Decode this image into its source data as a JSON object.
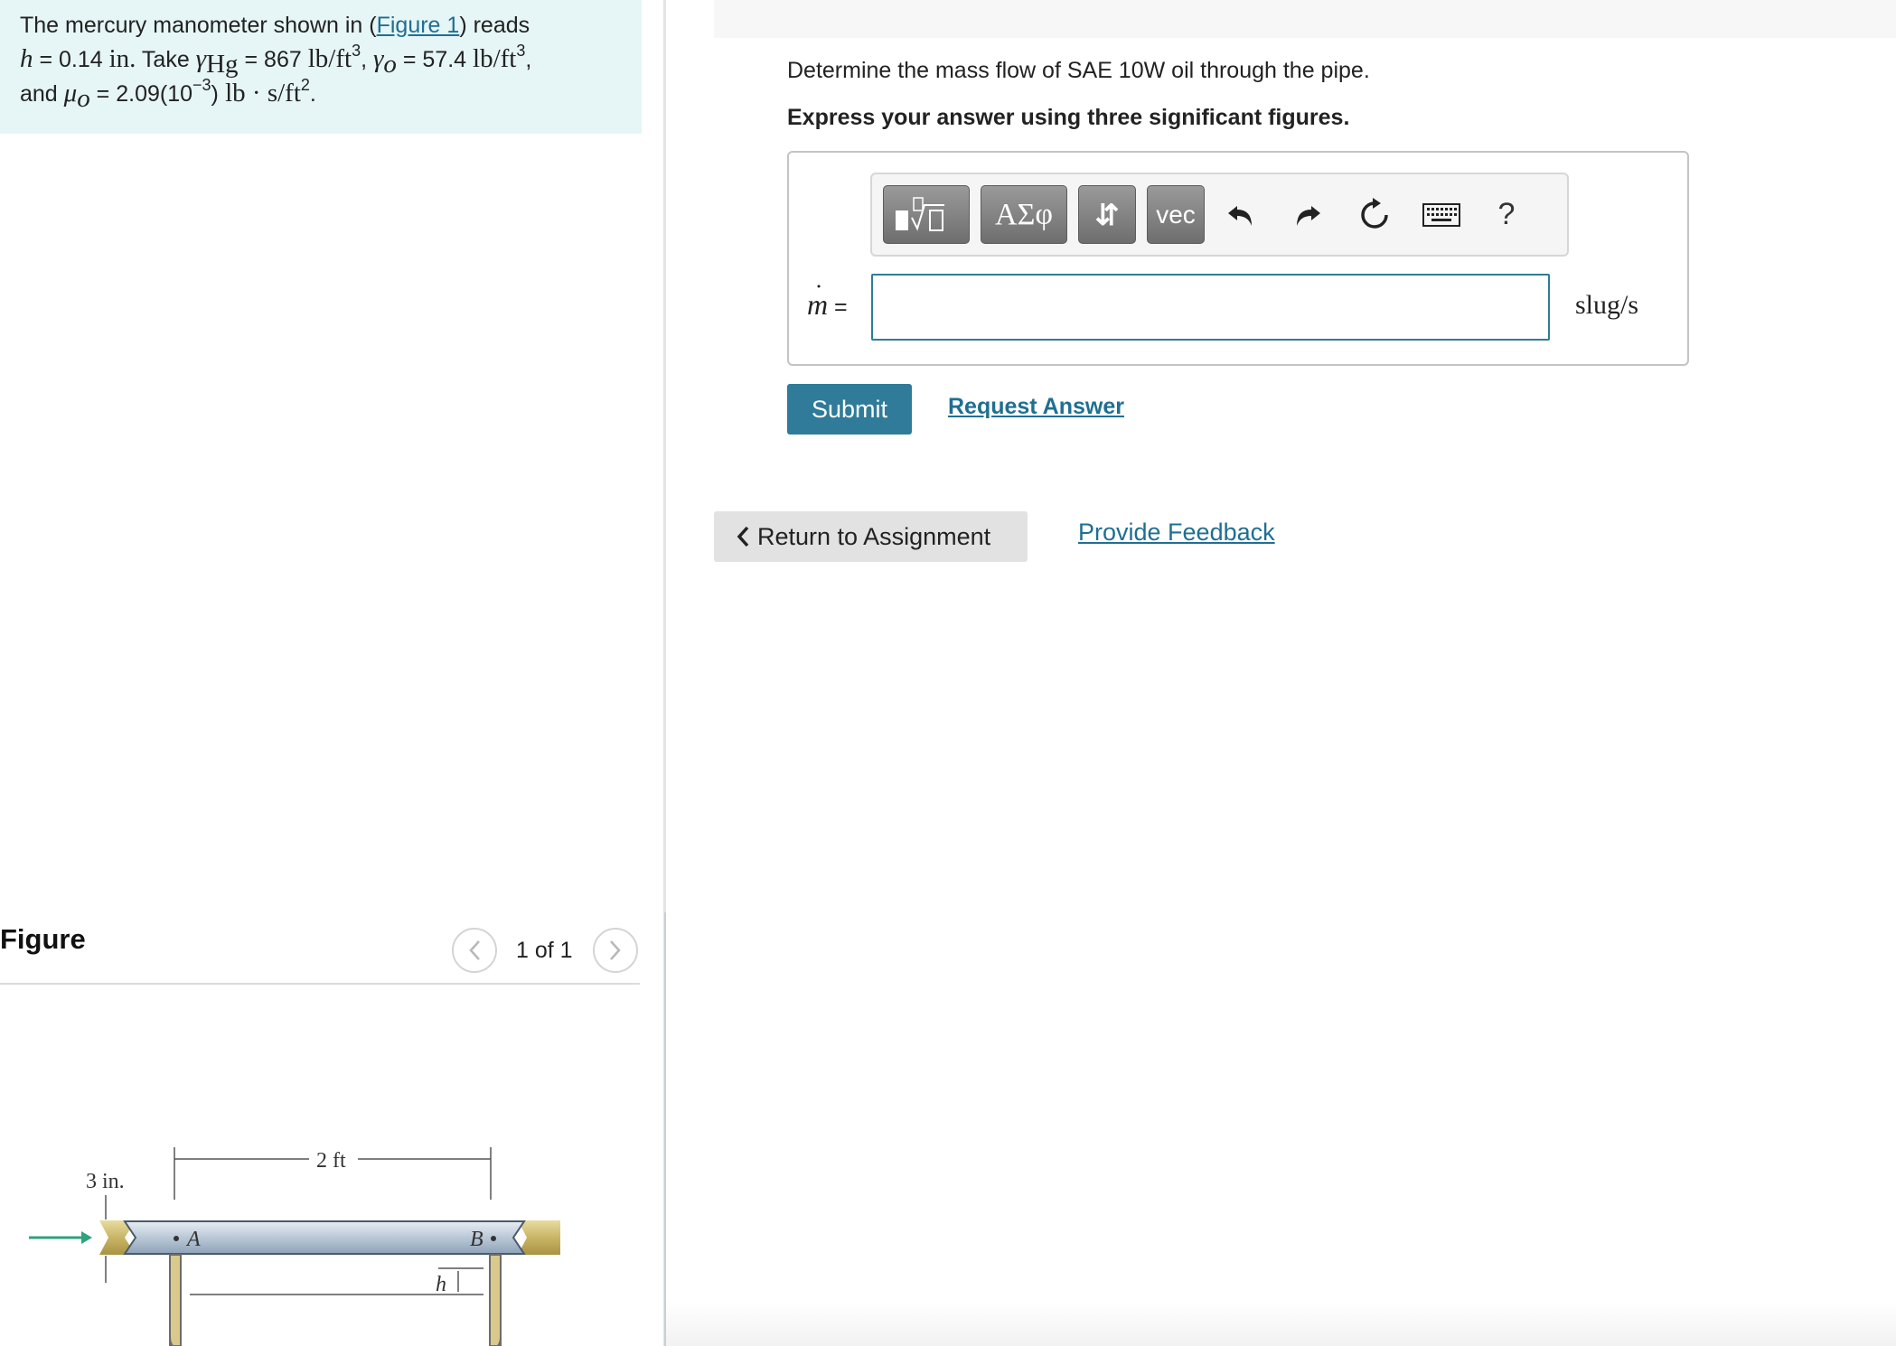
{
  "problem": {
    "intro": "The mercury manometer shown in (",
    "figure_link": "Figure 1",
    "reads": ") reads",
    "h_var": "h",
    "h_value": " = 0.14 ",
    "h_unit": "in.",
    "take": " Take ",
    "gamma": "γ",
    "gamma_hg_sub": "Hg",
    "gamma_hg_value": " = 867 ",
    "lb_ft": "lb/ft",
    "cube": "3",
    "comma": ", ",
    "gamma_o_sub": "o",
    "gamma_o_value": " = 57.4 ",
    "and_text": "and ",
    "mu": "μ",
    "mu_sub": "o",
    "mu_value": " = 2.09(10",
    "mu_exp": "−3",
    "mu_close": ")",
    "mu_unit": " lb · s/ft",
    "square": "2",
    "period": "."
  },
  "figure": {
    "title": "Figure",
    "pager": "1 of 1",
    "labels": {
      "length": "2 ft",
      "diameter": "3 in.",
      "point_a": "A",
      "point_b": "B",
      "h": "h"
    }
  },
  "question": {
    "text": "Determine the mass flow of SAE 10W oil through the pipe.",
    "instruction": "Express your answer using three significant figures."
  },
  "toolbar": {
    "greek": "ΑΣφ",
    "arrows": "⇵",
    "vec": "vec",
    "help": "?"
  },
  "answer": {
    "variable": "m",
    "dot": "˙",
    "equals": " =",
    "value": "",
    "unit": "slug/s"
  },
  "actions": {
    "submit": "Submit",
    "request_answer": "Request Answer",
    "return": "Return to Assignment",
    "feedback": "Provide Feedback"
  },
  "colors": {
    "problem_bg": "#e6f5f5",
    "link": "#1f6f92",
    "submit_bg": "#2f7b99",
    "input_border": "#2e7d96"
  }
}
